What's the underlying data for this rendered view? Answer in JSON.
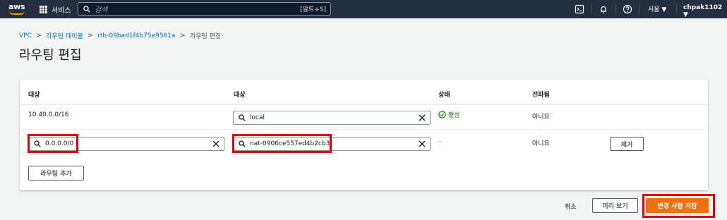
{
  "topnav": {
    "logo_text": "aws",
    "services_label": "서비스",
    "search_placeholder": "검색",
    "search_shortcut": "[알트+S]",
    "region": "서울 ▼",
    "user": "chpak1102 ▼"
  },
  "breadcrumb": {
    "items": [
      "VPC",
      "라우팅 테이블",
      "rtb-09bad1f4b75e9561a",
      "라우팅 편집"
    ],
    "separator": ">"
  },
  "page_title": "라우팅 편집",
  "table": {
    "headers": [
      "대상",
      "대상",
      "상태",
      "전파됨"
    ],
    "rows": [
      {
        "destination": "10.40.0.0/16",
        "target": "local",
        "status": "활성",
        "propagated": "아니요"
      },
      {
        "destination": "0.0.0.0/0",
        "target": "nat-0906ce557ed4b2cb3",
        "status": "–",
        "propagated": "아니요",
        "remove_label": "제거"
      }
    ],
    "add_route_label": "라우팅 추가"
  },
  "footer": {
    "cancel_label": "취소",
    "preview_label": "미리 보기",
    "save_label": "변경 사항 저장"
  },
  "colors": {
    "nav_bg": "#232f3e",
    "accent": "#ec7211",
    "link": "#0073bb",
    "highlight": "#e0000b",
    "success": "#1d8102"
  }
}
